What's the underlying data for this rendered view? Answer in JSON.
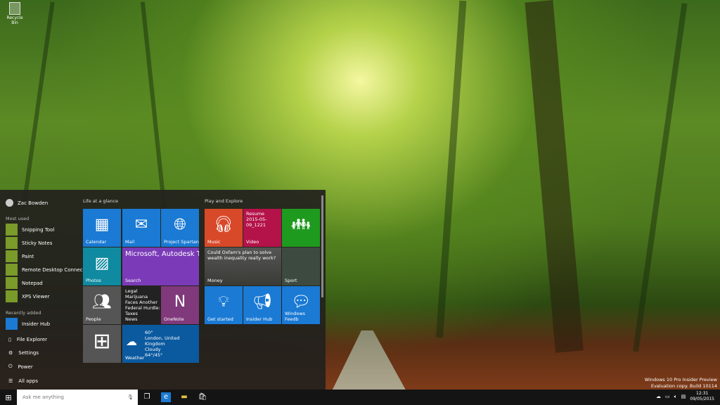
{
  "desktop": {
    "recycle_bin": "Recycle Bin",
    "watermark": [
      "Windows 10 Pro Insider Preview",
      "Evaluation copy. Build 10114"
    ]
  },
  "start": {
    "user": "Zac Bowden",
    "most_used_label": "Most used",
    "most_used": [
      "Snipping Tool",
      "Sticky Notes",
      "Paint",
      "Remote Desktop Connection",
      "Notepad",
      "XPS Viewer"
    ],
    "recently_added_label": "Recently added",
    "recently_added": [
      "Insider Hub"
    ],
    "system": [
      "File Explorer",
      "Settings",
      "Power",
      "All apps"
    ],
    "group1": "Life at a glance",
    "group2": "Play and Explore",
    "tiles": {
      "calendar": "Calendar",
      "mail": "Mail",
      "spartan": "Project Spartan",
      "photos": "Photos",
      "search_headline": "Microsoft, Autodesk To Tackle The Complex",
      "search": "Search",
      "people": "People",
      "news_headline": "Legal Marijuana Faces Another Federal Hurdle: Taxes",
      "news": "News",
      "onenote": "OneNote",
      "weather_temp": "60°",
      "weather_loc": "London, United Kingdom",
      "weather_cond": "Cloudy",
      "weather_range": "64°/45°",
      "weather": "Weather",
      "music": "Music",
      "video_resume": "Resume",
      "video_file": "2015-05-09_1221",
      "video": "Video",
      "money_headline": "Could Oxfam's plan to solve wealth inequality really work?",
      "money": "Money",
      "sport": "Sport",
      "get_started": "Get started",
      "insider_hub": "Insider Hub",
      "feedback": "Windows Feedb"
    }
  },
  "taskbar": {
    "search_placeholder": "Ask me anything",
    "time": "12:31",
    "date": "09/05/2015"
  }
}
